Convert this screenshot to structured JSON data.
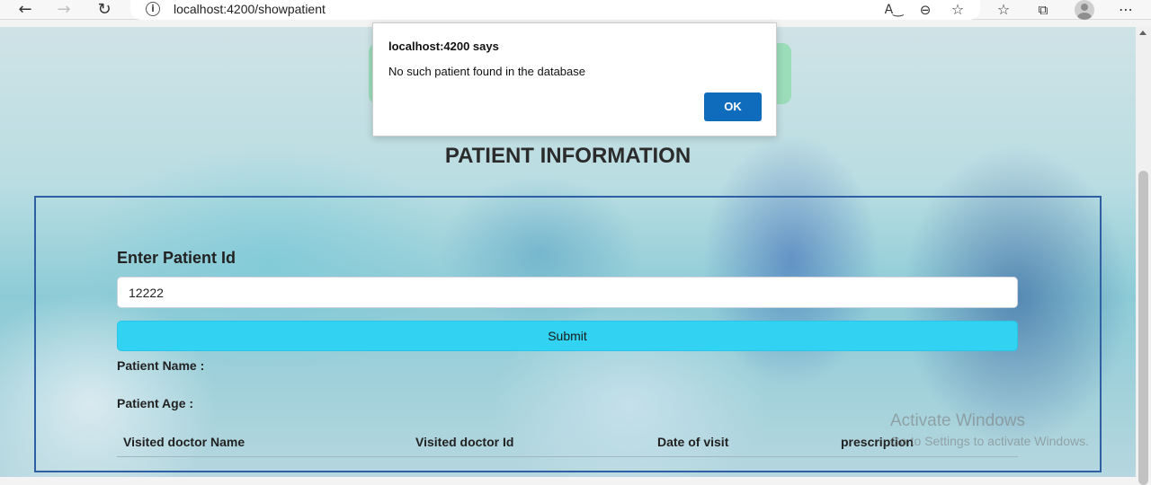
{
  "browser": {
    "url": "localhost:4200/showpatient",
    "icons": {
      "back": "back-arrow-icon",
      "forward": "forward-arrow-icon",
      "refresh": "refresh-icon",
      "site_info": "info-icon",
      "read_aloud": "read-aloud-icon",
      "zoom": "zoom-out-icon",
      "add_favorite": "add-favorite-icon",
      "favorites": "favorites-icon",
      "collections": "collections-icon",
      "profile": "profile-avatar",
      "more": "more-icon"
    }
  },
  "page": {
    "title": "PATIENT INFORMATION",
    "form": {
      "label": "Enter Patient Id",
      "patient_id_value": "12222",
      "submit_label": "Submit"
    },
    "details": {
      "name_label": "Patient Name :",
      "age_label": "Patient Age :"
    },
    "table": {
      "headers": [
        "Visited doctor Name",
        "Visited doctor Id",
        "Date of visit",
        "prescription"
      ]
    }
  },
  "dialog": {
    "title": "localhost:4200 says",
    "message": "No such patient found in the database",
    "ok_label": "OK"
  },
  "watermark": {
    "line1": "Activate Windows",
    "line2": "Go to Settings to activate Windows."
  },
  "colors": {
    "submit_button": "#31d2f2",
    "panel_border": "#2e5fa3",
    "dialog_ok": "#0f6cbd"
  }
}
